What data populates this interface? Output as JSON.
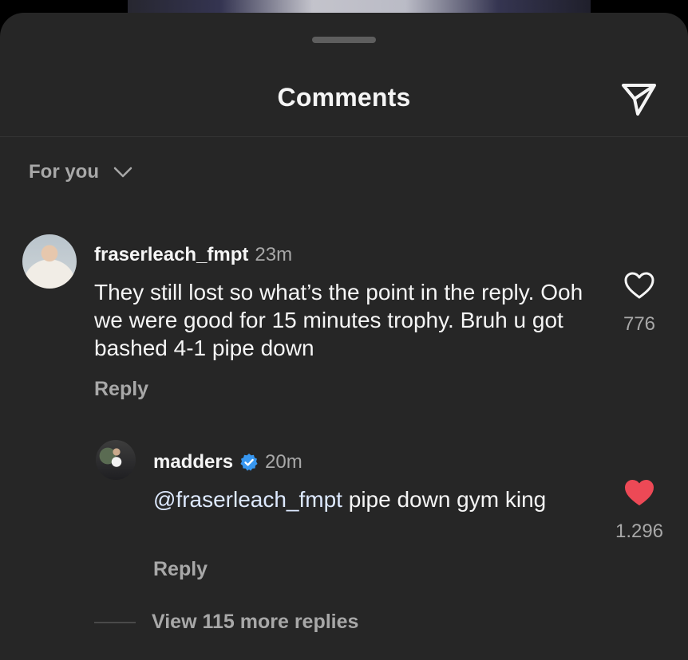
{
  "header": {
    "title": "Comments",
    "share_icon": "send-icon"
  },
  "filter": {
    "label": "For you",
    "icon": "chevron-down-icon"
  },
  "comments": [
    {
      "username": "fraserleach_fmpt",
      "time": "23m",
      "text": "They still lost so what’s the point in the reply. Ooh we were good for 15 minutes trophy. Bruh u got bashed 4-1 pipe down",
      "reply_label": "Reply",
      "likes": "776",
      "liked": false
    }
  ],
  "replies": [
    {
      "username": "madders",
      "verified": true,
      "time": "20m",
      "mention": "@fraserleach_fmpt",
      "text": " pipe down gym king",
      "reply_label": "Reply",
      "likes": "1.296",
      "liked": true
    }
  ],
  "view_more": {
    "label": "View 115 more replies"
  },
  "colors": {
    "sheet_bg": "#262626",
    "text_primary": "#f5f5f5",
    "text_secondary": "#a8a8a8",
    "like_red": "#ed4956",
    "verified_blue": "#3897f0"
  }
}
